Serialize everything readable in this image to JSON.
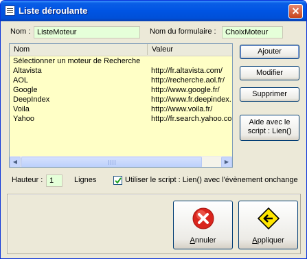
{
  "window": {
    "title": "Liste déroulante",
    "close_glyph": "✕"
  },
  "form": {
    "nom_label": "Nom :",
    "nom_value": "ListeMoteur",
    "formulaire_label": "Nom du formulaire :",
    "formulaire_value": "ChoixMoteur"
  },
  "list": {
    "columns": [
      "Nom",
      "Valeur"
    ],
    "rows": [
      {
        "nom": "Sélectionner un moteur de Recherche",
        "valeur": ""
      },
      {
        "nom": "Altavista",
        "valeur": "http://fr.altavista.com/"
      },
      {
        "nom": "AOL",
        "valeur": "http://recherche.aol.fr/"
      },
      {
        "nom": "Google",
        "valeur": "http://www.google.fr/"
      },
      {
        "nom": "DeepIndex",
        "valeur": "http://www.fr.deepindex."
      },
      {
        "nom": "Voila",
        "valeur": "http://www.voila.fr/"
      },
      {
        "nom": "Yahoo",
        "valeur": "http://fr.search.yahoo.co"
      }
    ],
    "scroll_left_glyph": "◀",
    "scroll_right_glyph": "▶"
  },
  "buttons": {
    "ajouter": "Ajouter",
    "modifier": "Modifier",
    "supprimer": "Supprimer",
    "aide_line1": "Aide avec le",
    "aide_line2": "script : Lien()"
  },
  "options": {
    "hauteur_label": "Hauteur :",
    "hauteur_value": "1",
    "lignes_label": "Lignes",
    "script_checked": true,
    "script_label": "Utiliser le script : Lien()  avec l'évènement onchange"
  },
  "actions": {
    "annuler_first": "A",
    "annuler_rest": "nnuler",
    "appliquer_first": "A",
    "appliquer_rest": "ppliquer"
  },
  "colors": {
    "titlebar": "#0054e3",
    "field_bg": "#e5ffd9",
    "list_bg": "#ffffc6",
    "window_bg": "#ece9d8",
    "cancel_red": "#d9251d",
    "apply_yellow": "#ffe600"
  },
  "icons": {
    "app": "list-icon",
    "cancel": "cancel-x-icon",
    "apply": "apply-arrow-icon"
  }
}
